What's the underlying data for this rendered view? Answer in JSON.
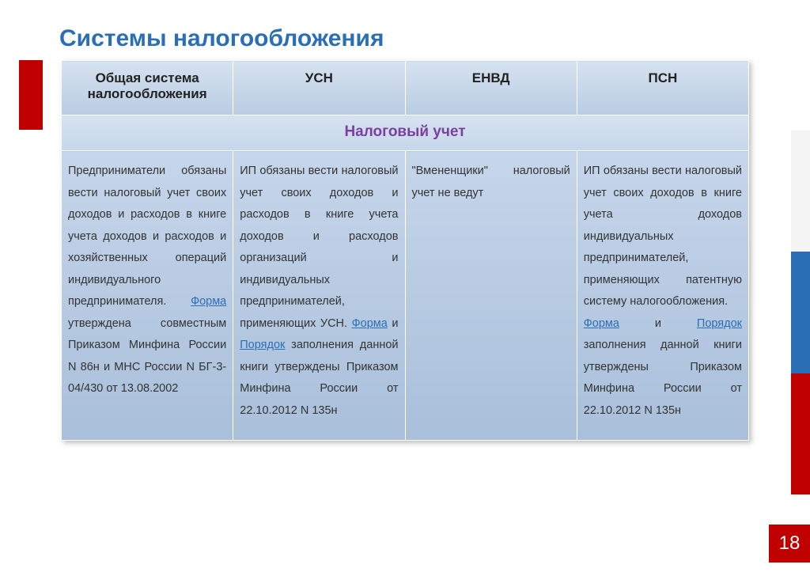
{
  "title": "Системы  налогообложения",
  "pageNumber": "18",
  "table": {
    "headers": [
      "Общая система налогообложения",
      "УСН",
      "ЕНВД",
      "ПСН"
    ],
    "subheader": "Налоговый учет",
    "cells": {
      "col1": {
        "pre": "Предприниматели обязаны вести налоговый учет своих доходов и расходов в книге учета доходов и расходов и хозяйственных операций индивидуального предпринимателя. ",
        "link1": "Форма",
        "post": " утверждена совместным Приказом Минфина России N 86н и МНС России N БГ-3-04/430 от 13.08.2002"
      },
      "col2": {
        "pre": "ИП обязаны вести налоговый учет своих доходов и расходов в книге учета доходов и расходов организаций и индивидуальных предпринимателей, применяющих УСН. ",
        "link1": "Форма",
        "mid": " и ",
        "link2": "Порядок",
        "post": " заполнения данной книги утверждены Приказом Минфина России от 22.10.2012 N 135н"
      },
      "col3": {
        "text": "\"Вмененщики\" налоговый учет не ведут"
      },
      "col4": {
        "pre": "ИП обязаны вести налоговый учет своих доходов в книге учета доходов индивидуальных предпринимателей, применяющих патентную систему налогообложения.",
        "link1": "Форма",
        "mid": " и ",
        "link2": "Порядок",
        "post": " заполнения данной книги утверждены Приказом Минфина России от 22.10.2012 N 135н"
      }
    }
  }
}
